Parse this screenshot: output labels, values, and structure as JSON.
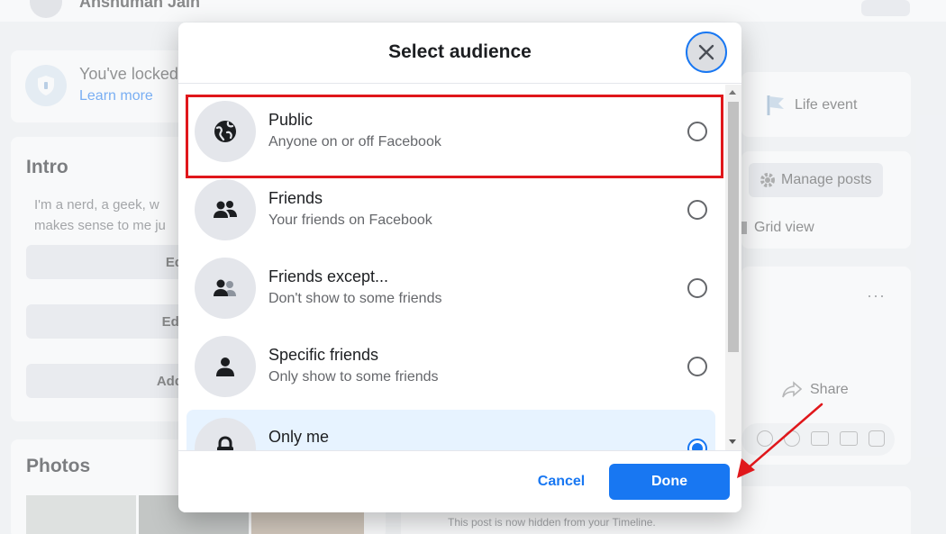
{
  "background": {
    "profile_name": "Anshuman Jain",
    "locked_notice": "You've locked",
    "learn_more": "Learn more",
    "intro_heading": "Intro",
    "bio_text": "I'm a nerd, a geek, w makes sense to me ju",
    "button_1": "Ed",
    "button_2": "Edi",
    "button_3": "Add",
    "photos_heading": "Photos",
    "life_event": "Life event",
    "manage_posts": "Manage posts",
    "grid_view": "Grid view",
    "share": "Share",
    "hidden_post_text": "This post is now hidden from your Timeline."
  },
  "dialog": {
    "title": "Select audience",
    "options": [
      {
        "title": "Public",
        "subtitle": "Anyone on or off Facebook",
        "icon": "globe-icon",
        "selected": false
      },
      {
        "title": "Friends",
        "subtitle": "Your friends on Facebook",
        "icon": "friends-icon",
        "selected": false
      },
      {
        "title": "Friends except...",
        "subtitle": "Don't show to some friends",
        "icon": "friends-except-icon",
        "selected": false
      },
      {
        "title": "Specific friends",
        "subtitle": "Only show to some friends",
        "icon": "person-icon",
        "selected": false
      },
      {
        "title": "Only me",
        "subtitle": "",
        "icon": "lock-icon",
        "selected": true
      }
    ],
    "cancel_label": "Cancel",
    "done_label": "Done"
  },
  "colors": {
    "accent": "#1877f2",
    "highlight": "#e0171b",
    "selected_bg": "#e7f3ff"
  }
}
